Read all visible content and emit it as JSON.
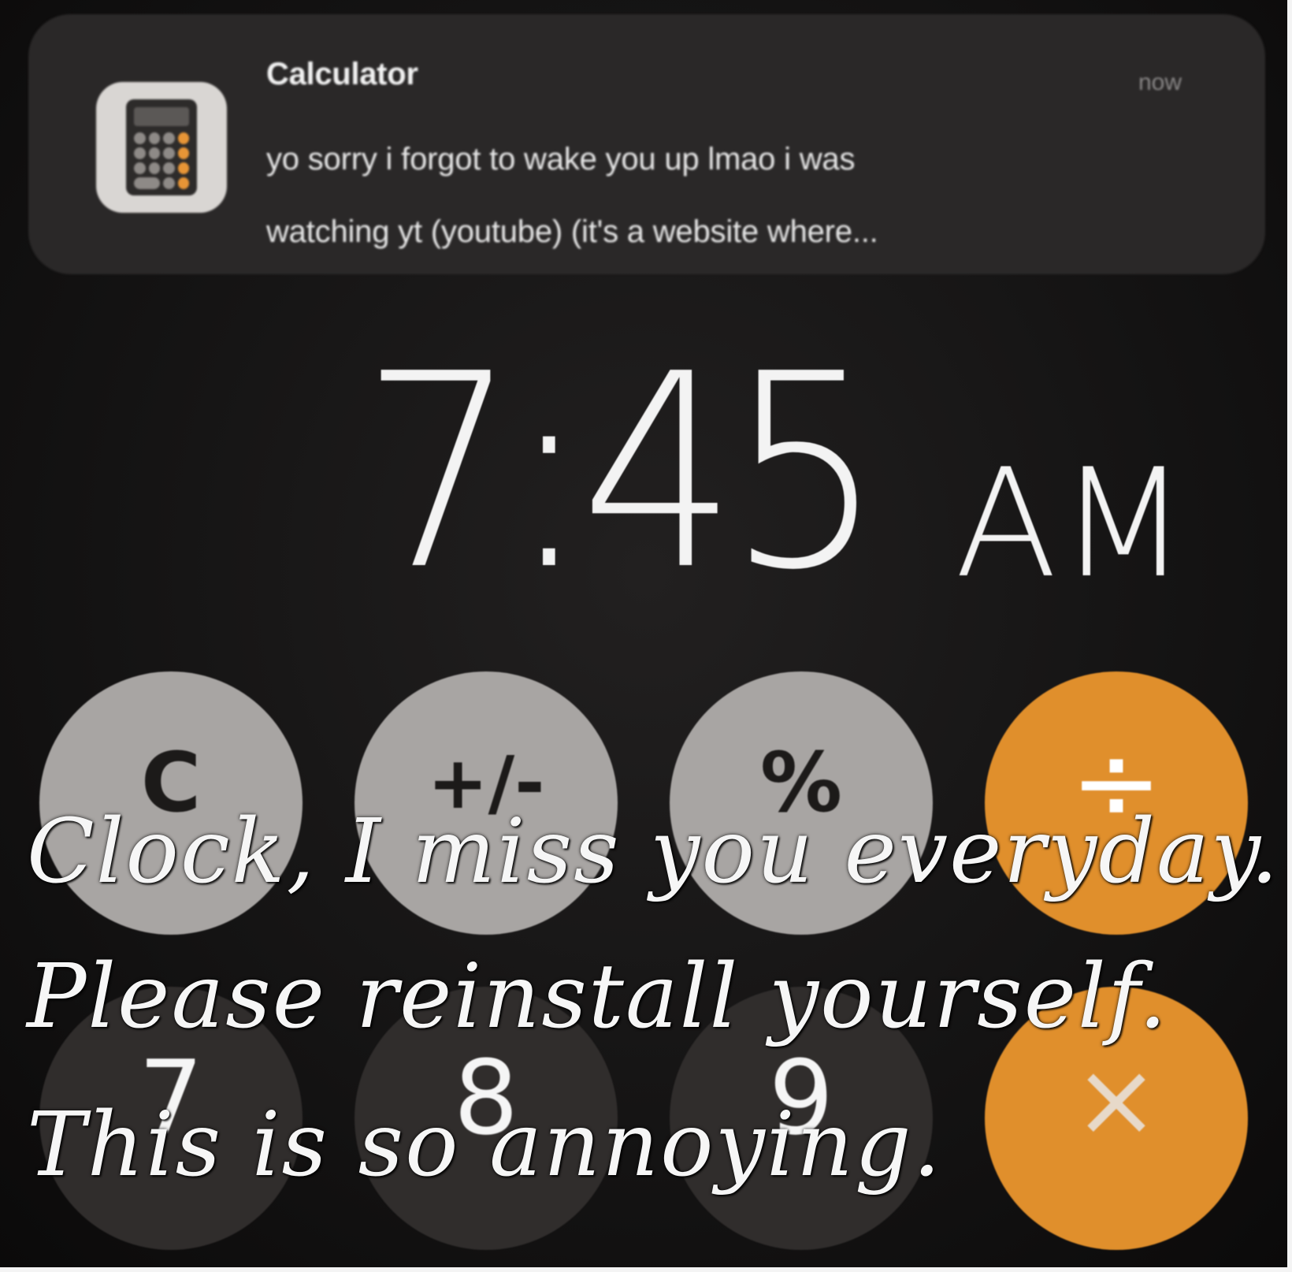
{
  "notification": {
    "app_name": "Calculator",
    "time": "now",
    "message_line1": "yo sorry i forgot to wake you up lmao i was",
    "message_line2": "watching yt (youtube) (it's a website where..."
  },
  "lockscreen": {
    "time": "7:45",
    "period": "AM"
  },
  "calculator_keys": {
    "clear": "C",
    "plus_minus": "+/-",
    "percent": "%",
    "divide": "÷",
    "seven": "7",
    "eight": "8",
    "nine": "9",
    "multiply": "×"
  },
  "caption": {
    "line1": "Clock, I miss you everyday.",
    "line2": "Please reinstall yourself.",
    "line3": "This is so annoying."
  },
  "colors": {
    "background": "#151414",
    "notification_bg": "#2a2828",
    "key_light": "#a8a5a3",
    "key_dark": "#302d2c",
    "key_orange": "#e08f2c"
  }
}
